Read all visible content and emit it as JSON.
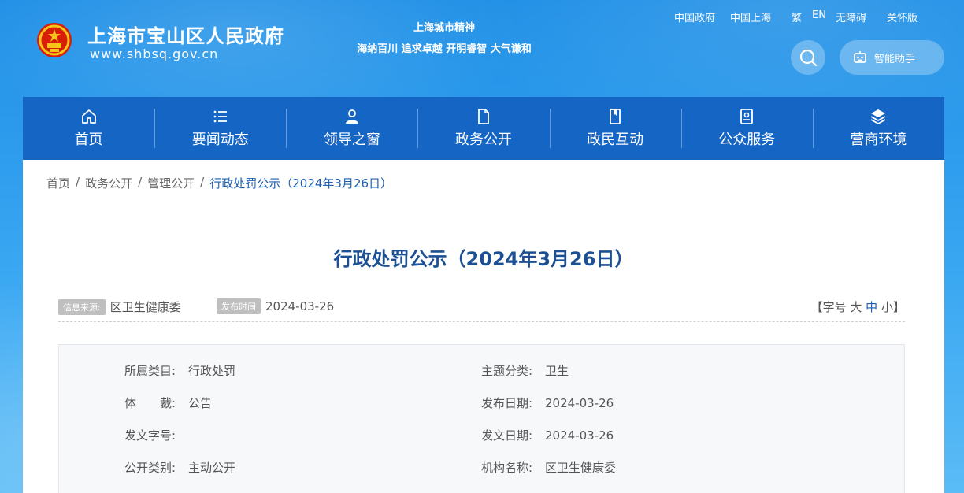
{
  "header": {
    "site_title": "上海市宝山区人民政府",
    "site_url": "www.shbsq.gov.cn",
    "slogan_line1": "上海城市精神",
    "slogan_line2": "海纳百川 追求卓越 开明睿智 大气谦和",
    "top_links": [
      "中国政府",
      "中国上海",
      "繁",
      "EN",
      "无障碍",
      "关怀版"
    ],
    "assistant_label": "智能助手"
  },
  "nav": {
    "items": [
      {
        "label": "首页",
        "icon": "home-icon"
      },
      {
        "label": "要闻动态",
        "icon": "list-icon"
      },
      {
        "label": "领导之窗",
        "icon": "person-icon"
      },
      {
        "label": "政务公开",
        "icon": "document-icon"
      },
      {
        "label": "政民互动",
        "icon": "bookmark-icon"
      },
      {
        "label": "公众服务",
        "icon": "service-icon"
      },
      {
        "label": "营商环境",
        "icon": "layers-icon"
      }
    ]
  },
  "breadcrumb": [
    "首页",
    "政务公开",
    "管理公开",
    "行政处罚公示（2024年3月26日）"
  ],
  "article": {
    "title": "行政处罚公示（2024年3月26日）",
    "source_tag": "信息来源:",
    "source": "区卫生健康委",
    "date_tag": "发布时间",
    "date": "2024-03-26",
    "font_size": {
      "open": "【字号",
      "large": "大",
      "medium": "中",
      "small": "小",
      "close": "】"
    }
  },
  "info": {
    "category_label": "所属类目:",
    "category": "行政处罚",
    "topic_label": "主题分类:",
    "topic": "卫生",
    "genre_label": "体　　裁:",
    "genre": "公告",
    "publish_date_label": "发布日期:",
    "publish_date": "2024-03-26",
    "doc_no_label": "发文字号:",
    "doc_no": "",
    "doc_date_label": "发文日期:",
    "doc_date": "2024-03-26",
    "open_type_label": "公开类别:",
    "open_type": "主动公开",
    "org_label": "机构名称:",
    "org": "区卫生健康委"
  },
  "colors": {
    "nav_bg": "#1565c5",
    "title": "#1d5092",
    "link_active": "#1d5fb0"
  }
}
